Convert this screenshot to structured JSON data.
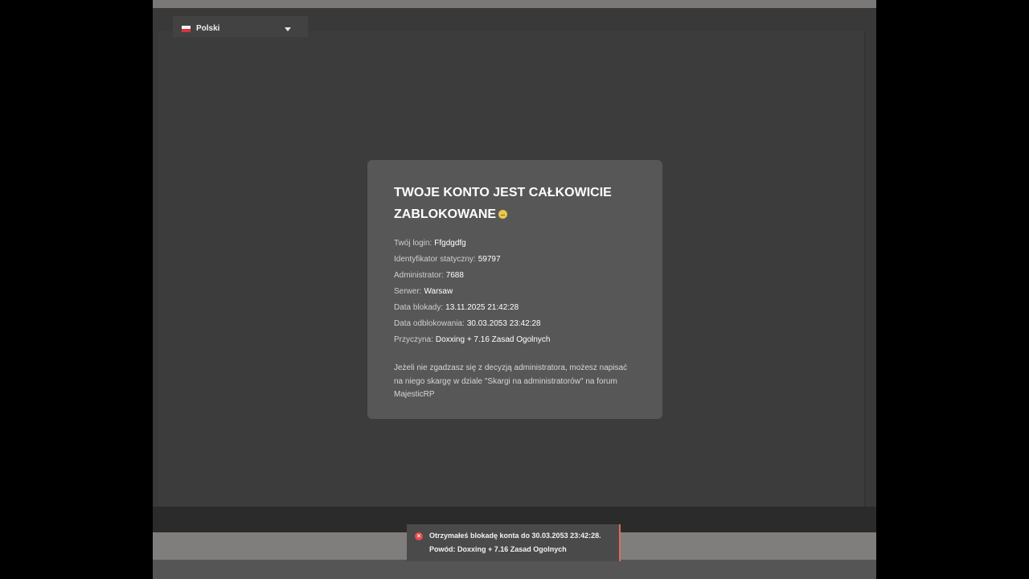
{
  "language_selector": {
    "label": "Polski",
    "flag_colors": [
      "#f3f3f3",
      "#d8323a"
    ]
  },
  "ban_card": {
    "title": "TWOJE KONTO JEST CAŁKOWICIE ZABLOKOWANE",
    "fields": [
      {
        "label": "Twój login:",
        "value": "Ffgdgdfg"
      },
      {
        "label": "Identyfikator statyczny:",
        "value": "59797"
      },
      {
        "label": "Administrator:",
        "value": "7688"
      },
      {
        "label": "Serwer:",
        "value": "Warsaw"
      },
      {
        "label": "Data blokady:",
        "value": "13.11.2025 21:42:28"
      },
      {
        "label": "Data odblokowania:",
        "value": "30.03.2053 23:42:28"
      },
      {
        "label": "Przyczyna:",
        "value": "Doxxing + 7.16 Zasad Ogolnych"
      }
    ],
    "note": "Jeżeli nie zgadzasz się z decyzją administratora, możesz napisać na niego skargę w dziale \"Skargi na administratorów\" na forum MajesticRP"
  },
  "notification": {
    "icon": "error-icon",
    "line1": "Otrzymałeś blokadę konta do 30.03.2053 23:42:28.",
    "line2": "Powód: Doxxing + 7.16 Zasad Ogolnych",
    "accent_color": "#e06a5b"
  }
}
